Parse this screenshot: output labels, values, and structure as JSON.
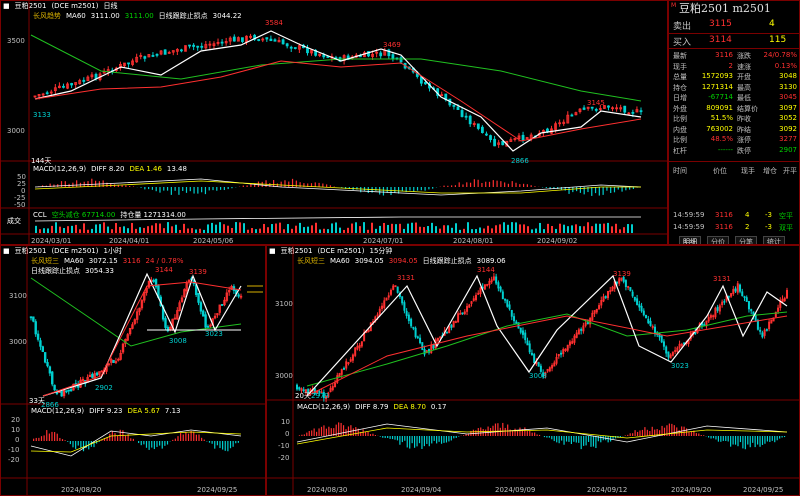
{
  "top_chart": {
    "symbol": "豆粕2501",
    "exchange": "(DCE m2501)",
    "period": "日线",
    "ind_name": "长风趋势",
    "ma_label": "MA60",
    "ma_value": "3111.00",
    "ma_value2": "3111.00",
    "stop_label": "日线跟踪止损点",
    "stop_value": "3044.22",
    "y_ticks": [
      "3500",
      "3000"
    ],
    "labels": {
      "high1": "3584",
      "high2": "3469",
      "high3": "3145",
      "low1": "3133",
      "low2": "2866",
      "bars": "144天"
    },
    "macd_title": "MACD(12,26,9)",
    "macd_diff": "DIFF 8.20",
    "macd_dea": "DEA 1.46",
    "macd_macd": "13.48",
    "macd_ticks": [
      "50",
      "25",
      "0",
      "-25",
      "-50"
    ],
    "vol_label": "成交",
    "ccl_label": "CCL",
    "ccl_text": "空头减仓 67714.00",
    "oi_text": "持仓量 1271314.00",
    "x_dates": [
      "2024/03/01",
      "2024/04/01",
      "2024/05/06",
      "2024/07/01",
      "2024/08/01",
      "2024/09/02"
    ]
  },
  "quote": {
    "title": "豆粕2501  m2501",
    "sell": {
      "label": "卖出",
      "price": "3115",
      "vol": "4"
    },
    "buy": {
      "label": "买入",
      "price": "3114",
      "vol": "115"
    },
    "rows": [
      {
        "l1": "最新",
        "v1": "3116",
        "l2": "涨跌",
        "v2": "24/0.78%"
      },
      {
        "l1": "现手",
        "v1": "2",
        "l2": "速涨",
        "v2": "0.13%"
      },
      {
        "l1": "总量",
        "v1": "1572093",
        "l2": "开盘",
        "v2": "3048"
      },
      {
        "l1": "持仓",
        "v1": "1271314",
        "l2": "最高",
        "v2": "3130"
      },
      {
        "l1": "日增",
        "v1": "-67714",
        "l2": "最低",
        "v2": "3045"
      },
      {
        "l1": "外盘",
        "v1": "809091",
        "l2": "结算价",
        "v2": "3097"
      },
      {
        "l1": "比例",
        "v1": "51.5%",
        "l2": "昨收",
        "v2": "3052"
      },
      {
        "l1": "内盘",
        "v1": "763002",
        "l2": "昨结",
        "v2": "3092"
      },
      {
        "l1": "比例",
        "v1": "48.5%",
        "l2": "涨停",
        "v2": "3277"
      },
      {
        "l1": "杠杆",
        "v1": "------",
        "l2": "跌停",
        "v2": "2907"
      }
    ],
    "tick_header": [
      "时间",
      "价位",
      "现手",
      "增仓",
      "开平"
    ],
    "ticks": [
      {
        "time": "14:59:59",
        "price": "3116",
        "vol": "4",
        "oi": "-3",
        "type": "空平"
      },
      {
        "time": "14:59:59",
        "price": "3116",
        "vol": "2",
        "oi": "-3",
        "type": "双平"
      }
    ],
    "tabs": [
      "明细",
      "分价",
      "分笔",
      "统计"
    ]
  },
  "left_chart": {
    "symbol": "豆粕2501",
    "exchange": "(DCE m2501)",
    "period": "1小时",
    "ind_name": "长风短三",
    "ma_label": "MA60",
    "ma_value": "3072.15",
    "last": "3116",
    "change": "24 / 0.78%",
    "stop_label": "日线跟踪止损点",
    "stop_value": "3054.33",
    "y_ticks": [
      "3100",
      "3000"
    ],
    "labels": {
      "h1": "3144",
      "h2": "3139",
      "l1": "3008",
      "l2": "3023",
      "l3": "2902",
      "l4": "2866",
      "bars": "33天"
    },
    "macd_title": "MACD(12,26,9)",
    "macd_diff": "DIFF 9.23",
    "macd_dea": "DEA 5.67",
    "macd_macd": "7.13",
    "macd_ticks": [
      "20",
      "10",
      "0",
      "-10",
      "-20"
    ],
    "x_dates": [
      "2024/08/20",
      "2024/09/25"
    ]
  },
  "right_chart": {
    "symbol": "豆粕2501",
    "exchange": "(DCE m2501)",
    "period": "15分钟",
    "ind_name": "长风短三",
    "ma_label": "MA60",
    "ma_value": "3094.05",
    "ma_value2": "3094.05",
    "last": "3116",
    "change": "24 / 0.78%",
    "stop_label": "日线跟踪止损点",
    "stop_value": "3089.06",
    "y_ticks": [
      "3100",
      "3000"
    ],
    "labels": {
      "h1": "3131",
      "h2": "3144",
      "h3": "3139",
      "h4": "3131",
      "l1": "2979",
      "l2": "3008",
      "l3": "3023",
      "bars": "20天"
    },
    "macd_title": "MACD(12,26,9)",
    "macd_diff": "DIFF 8.79",
    "macd_dea": "DEA 8.70",
    "macd_macd": "0.17",
    "macd_ticks": [
      "10",
      "0",
      "-10",
      "-20"
    ],
    "x_dates": [
      "2024/08/30",
      "2024/09/04",
      "2024/09/09",
      "2024/09/12",
      "2024/09/20",
      "2024/09/25"
    ]
  },
  "colors": {
    "up": "#ff3030",
    "down": "#00d0d0",
    "ma": "#20c020",
    "border": "#7a0000"
  }
}
